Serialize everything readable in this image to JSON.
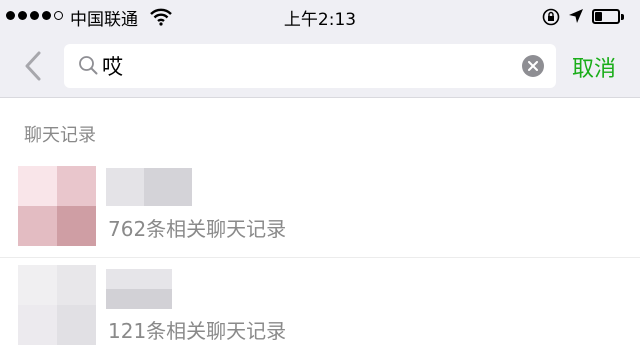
{
  "status_bar": {
    "carrier": "中国联通",
    "time": "上午2:13",
    "signal_icon": "signal-dots-icon",
    "wifi_icon": "wifi-icon",
    "rotation_lock_icon": "rotation-lock-icon",
    "location_icon": "location-arrow-icon",
    "battery_icon": "battery-icon",
    "battery_level": 0.3
  },
  "search": {
    "back_icon": "chevron-left-icon",
    "search_icon": "search-icon",
    "query": "哎",
    "clear_icon": "clear-circle-icon",
    "cancel_label": "取消",
    "accent_color": "#1aad19"
  },
  "results": {
    "section_title": "聊天记录",
    "items": [
      {
        "summary": "762条相关聊天记录"
      },
      {
        "summary": "121条相关聊天记录"
      }
    ]
  }
}
